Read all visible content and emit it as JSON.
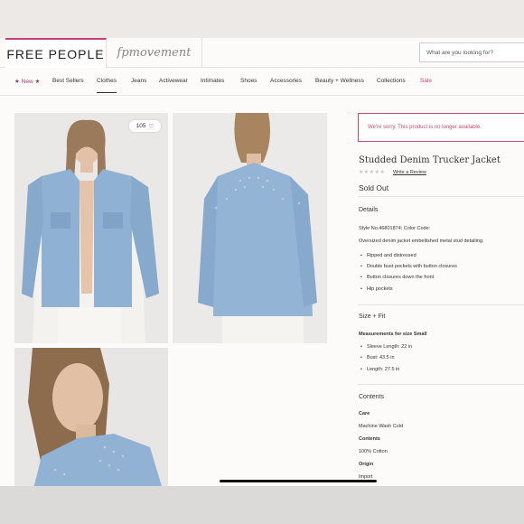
{
  "header": {
    "logo_primary": "FREE PEOPLE",
    "logo_secondary": "fpmovement",
    "search_placeholder": "What are you looking for?"
  },
  "nav": {
    "items": [
      {
        "label": "★ New ★"
      },
      {
        "label": "Best Sellers"
      },
      {
        "label": "Clothes"
      },
      {
        "label": "Jeans"
      },
      {
        "label": "Activewear"
      },
      {
        "label": "Intimates"
      },
      {
        "label": "Shoes"
      },
      {
        "label": "Accessories"
      },
      {
        "label": "Beauty + Wellness"
      },
      {
        "label": "Collections"
      },
      {
        "label": "Sale"
      }
    ],
    "active": "Clothes"
  },
  "gallery": {
    "favorite_count": "105"
  },
  "product": {
    "alert": "We're sorry. This product is no longer available.",
    "title": "Studded Denim Trucker Jacket",
    "rating_stars": "★★★★★",
    "review_link": "Write a Review",
    "status": "Sold Out"
  },
  "details": {
    "heading": "Details",
    "style_line": "Style No.46801874; Color Code:",
    "description": "Oversized denim jacket embellished metal stud detailing.",
    "bullets": [
      "Ripped and distressed",
      "Double bust pockets with button closures",
      "Button closures down the front",
      "Hip pockets"
    ]
  },
  "size_fit": {
    "heading": "Size + Fit",
    "measurements_label": "Measurements for size Small",
    "bullets": [
      "Sleeve Length: 22 in",
      "Bust: 43.5 in",
      "Length: 27.5 in"
    ]
  },
  "contents": {
    "heading": "Contents",
    "care_label": "Care",
    "care_value": "Machine Wash Cold",
    "contents_label": "Contents",
    "contents_value": "100% Cotton",
    "origin_label": "Origin",
    "origin_value": "Import"
  },
  "colors": {
    "brand_pink": "#c8407a",
    "alert_red": "#c24d6c",
    "background": "#fcfbfa"
  }
}
